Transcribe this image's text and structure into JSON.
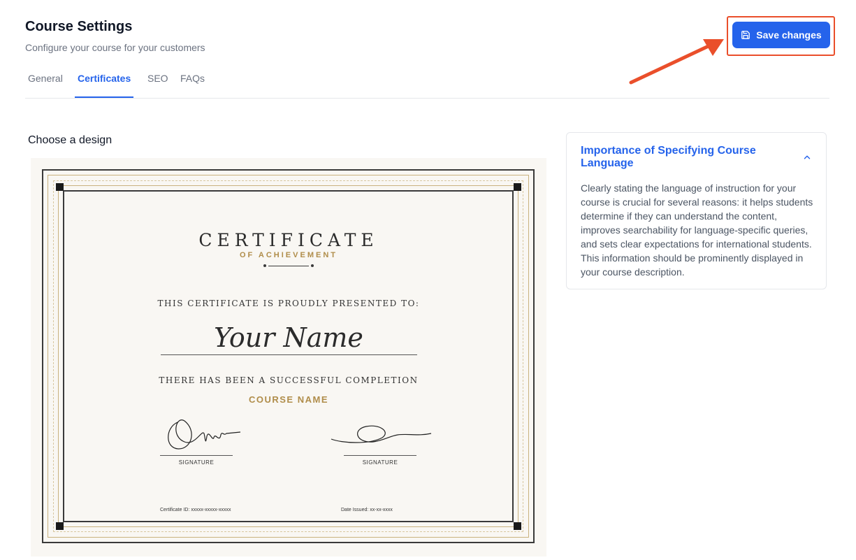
{
  "header": {
    "title": "Course Settings",
    "subtitle": "Configure your course for your customers"
  },
  "tabs": [
    {
      "label": "General",
      "active": false
    },
    {
      "label": "Certificates",
      "active": true
    },
    {
      "label": "SEO",
      "active": false
    },
    {
      "label": "FAQs",
      "active": false
    }
  ],
  "toolbar": {
    "save_label": "Save changes",
    "save_icon": "save-icon"
  },
  "design": {
    "label": "Choose a design"
  },
  "certificate": {
    "title": "CERTIFICATE",
    "subtitle": "OF ACHIEVEMENT",
    "presented": "THIS CERTIFICATE IS PROUDLY PRESENTED TO:",
    "name": "Your Name",
    "completion": "THERE HAS BEEN A SUCCESSFUL COMPLETION",
    "course": "COURSE NAME",
    "signature_label_1": "SIGNATURE",
    "signature_label_2": "SIGNATURE",
    "certificate_id": "Certificate ID: xxxxx-xxxxx-xxxxx",
    "date_issued": "Date Issued: xx-xx-xxxx"
  },
  "info_card": {
    "title": "Importance of Specifying Course Language",
    "body": "Clearly stating the language of instruction for your course is crucial for several reasons: it helps students determine if they can understand the content, improves searchability for language-specific queries, and sets clear expectations for international students. This information should be prominently displayed in your course description.",
    "expanded": true
  },
  "colors": {
    "accent": "#2563eb",
    "highlight": "#ea4f2b",
    "gold": "#b08d4a"
  }
}
